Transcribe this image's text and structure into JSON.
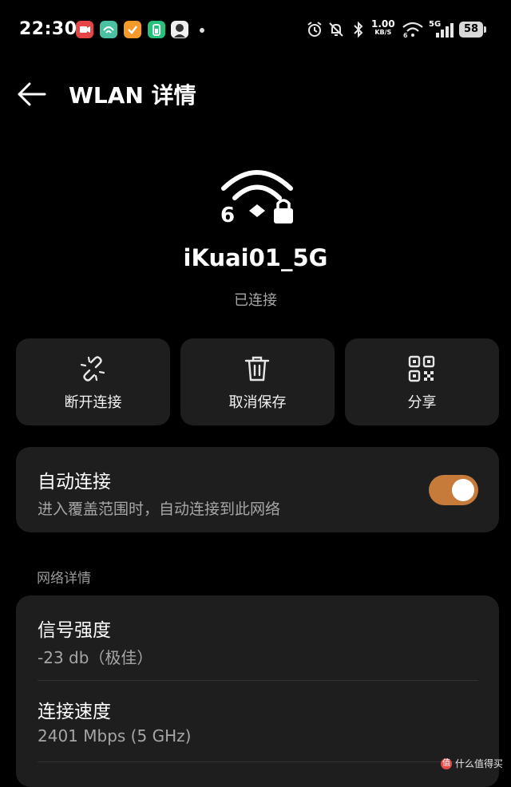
{
  "status_bar": {
    "time": "22:30",
    "apps": [
      {
        "name": "video-app-icon",
        "color": "#e64545"
      },
      {
        "name": "scan-app-icon",
        "color": "#49c0a0"
      },
      {
        "name": "tasks-app-icon",
        "color": "#f39a2a"
      },
      {
        "name": "battery-app-icon",
        "color": "#27c07c"
      },
      {
        "name": "avatar-app-icon",
        "color": "#f0f0f0"
      }
    ],
    "speed_value": "1.00",
    "speed_unit": "KB/S",
    "network_type": "5G",
    "battery_level": "58"
  },
  "header": {
    "title": "WLAN 详情"
  },
  "network": {
    "ssid": "iKuai01_5G",
    "status": "已连接",
    "wifi_generation": "6"
  },
  "actions": [
    {
      "label": "断开连接",
      "icon": "disconnect-link-icon"
    },
    {
      "label": "取消保存",
      "icon": "trash-icon"
    },
    {
      "label": "分享",
      "icon": "qr-code-icon"
    }
  ],
  "auto_connect": {
    "title": "自动连接",
    "description": "进入覆盖范围时，自动连接到此网络",
    "enabled": true,
    "accent_color": "#c77b3a"
  },
  "details": {
    "section_label": "网络详情",
    "items": [
      {
        "title": "信号强度",
        "value": "-23 db（极佳）"
      },
      {
        "title": "连接速度",
        "value": "2401 Mbps (5 GHz)"
      }
    ]
  },
  "watermark": {
    "text": "什么值得买",
    "badge": "值"
  }
}
